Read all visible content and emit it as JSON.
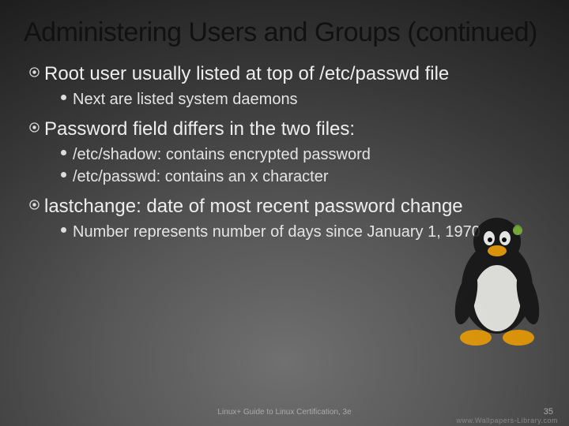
{
  "title": "Administering Users and Groups (continued)",
  "bullets": [
    {
      "text": "Root user usually listed at top of /etc/passwd file",
      "sub": [
        "Next are listed system daemons"
      ]
    },
    {
      "text": "Password field differs in the two files:",
      "sub": [
        "/etc/shadow: contains encrypted password",
        "/etc/passwd: contains an x character"
      ]
    },
    {
      "text": "lastchange: date of most recent password change",
      "sub": [
        "Number represents number of days since January 1, 1970"
      ]
    }
  ],
  "footer": "Linux+ Guide to Linux Certification, 3e",
  "page_number": "35",
  "watermark": "www.Wallpapers-Library.com",
  "decorative": {
    "mascot": "tux-penguin"
  }
}
